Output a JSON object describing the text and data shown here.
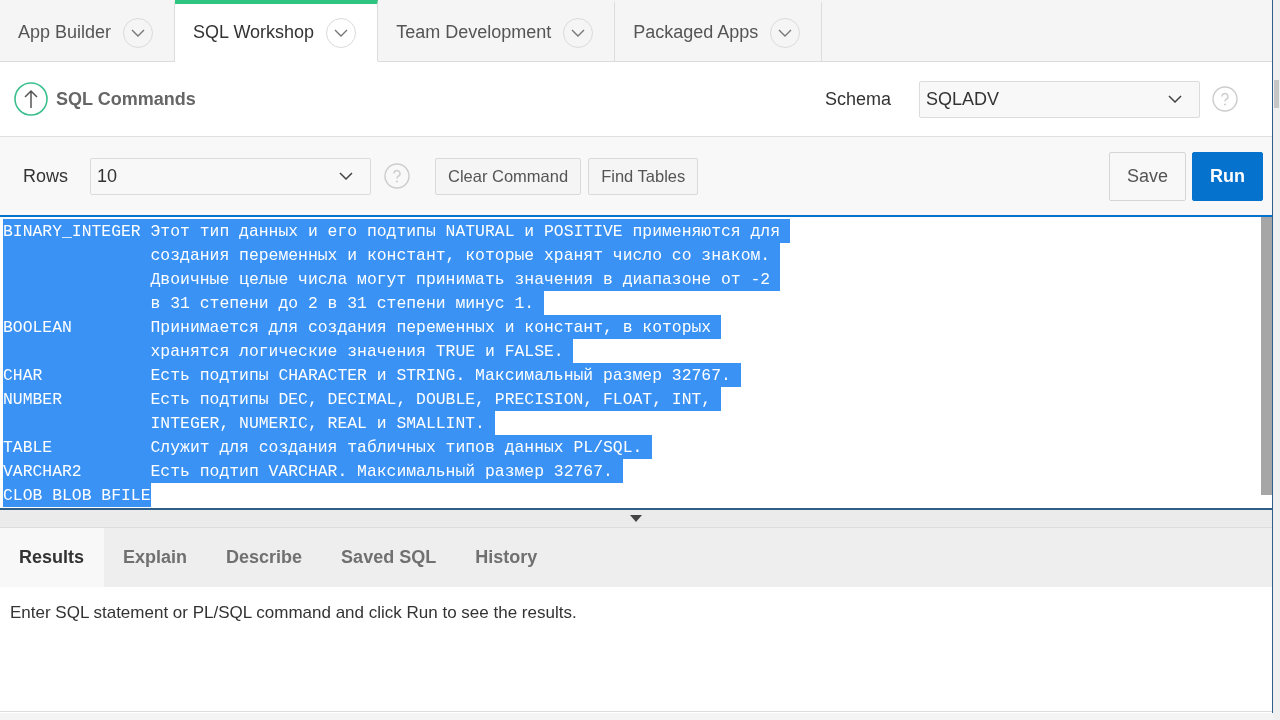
{
  "nav_tabs": [
    {
      "label": "App Builder",
      "selected": false
    },
    {
      "label": "SQL Workshop",
      "selected": true
    },
    {
      "label": "Team Development",
      "selected": false
    },
    {
      "label": "Packaged Apps",
      "selected": false
    }
  ],
  "header": {
    "title": "SQL Commands",
    "schema": {
      "label": "Schema",
      "value": "SQLADV"
    }
  },
  "toolbar": {
    "rows": {
      "label": "Rows",
      "value": "10"
    },
    "buttons": [
      {
        "label": "Clear Command"
      },
      {
        "label": "Find Tables"
      }
    ],
    "actions": [
      {
        "label": "Save",
        "kind": "secondary"
      },
      {
        "label": "Run",
        "kind": "primary"
      }
    ]
  },
  "editor": {
    "selected": true,
    "entries": [
      {
        "name": "BINARY_INTEGER",
        "lines": [
          "Этот тип данных и его подтипы NATURAL и POSITIVE применяются для",
          "создания переменных и констант, которые хранят число со знаком.",
          "Двоичные целые числа могут принимать значения в диапазоне от -2",
          "в 31 степени до 2 в 31 степени минус 1."
        ]
      },
      {
        "name": "BOOLEAN",
        "lines": [
          "Принимается для создания переменных и констант, в которых",
          "хранятся логические значения TRUE и FALSE."
        ]
      },
      {
        "name": "CHAR",
        "lines": [
          "Есть подтипы CHARACTER и STRING. Максимальный размер 32767."
        ]
      },
      {
        "name": "NUMBER",
        "lines": [
          "Есть подтипы DEC, DECIMAL, DOUBLE, PRECISION, FLOAT, INT,",
          "INTEGER, NUMERIC, REAL и SMALLINT."
        ]
      },
      {
        "name": "TABLE",
        "lines": [
          "Служит для создания табличных типов данных PL/SQL."
        ]
      },
      {
        "name": "VARCHAR2",
        "lines": [
          "Есть подтип VARCHAR. Максимальный размер 32767."
        ]
      },
      {
        "name": "CLOB BLOB BFILE"
      }
    ]
  },
  "result_tabs": [
    {
      "label": "Results",
      "selected": true
    },
    {
      "label": "Explain",
      "selected": false
    },
    {
      "label": "Describe",
      "selected": false
    },
    {
      "label": "Saved SQL",
      "selected": false
    },
    {
      "label": "History",
      "selected": false
    }
  ],
  "results": {
    "message": "Enter SQL statement or PL/SQL command and click Run to see the results."
  }
}
